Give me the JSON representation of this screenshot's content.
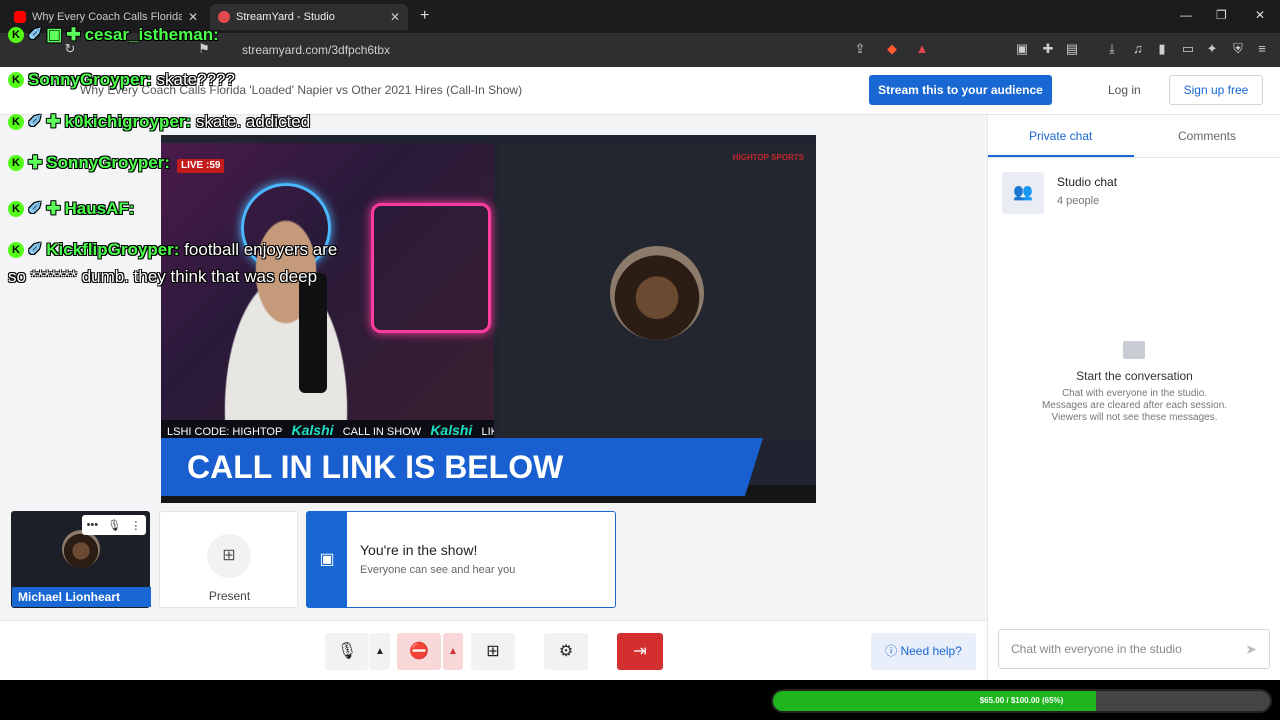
{
  "browser": {
    "tabs": [
      {
        "label": "Why Every Coach Calls Florida 'Loade",
        "favicon_color": "#ff0000"
      },
      {
        "label": "StreamYard - Studio",
        "favicon_color": "#e34b4b"
      }
    ],
    "url": "streamyard.com/3dfpch6tbx"
  },
  "header": {
    "show_title": "Why Every Coach Calls Florida 'Loaded' Napier vs Other 2021 Hires (Call-In Show)",
    "stream_button": "Stream this to your audience",
    "login": "Log in",
    "signup": "Sign up free"
  },
  "stage": {
    "live_badge": "LIVE :59",
    "ticker": [
      "LSHI CODE: HIGHTOP",
      "Kalshi",
      "CALL IN SHOW",
      "Kalshi",
      "LIKE"
    ],
    "banner": "CALL IN LINK IS BELOW",
    "logo": "HIGHTOP SPORTS"
  },
  "thumbs": {
    "guest_name": "Michael Lionheart",
    "present_label": "Present",
    "notice_title": "You're in the show!",
    "notice_sub": "Everyone can see and hear you"
  },
  "controls": {
    "help": "Need help?"
  },
  "sidebar": {
    "tabs": [
      "Private chat",
      "Comments"
    ],
    "room_name": "Studio chat",
    "room_count": "4 people",
    "empty_title": "Start the conversation",
    "empty_lines": [
      "Chat with everyone in the studio.",
      "Messages are cleared after each session.",
      "Viewers will not see these messages."
    ],
    "input_placeholder": "Chat with everyone in the studio"
  },
  "overlay_chat": [
    {
      "name": "cesar_istheman:",
      "message": ""
    },
    {
      "name": "SonnyGroyper:",
      "message": "skate????"
    },
    {
      "name": "k0kichigroyper:",
      "message": "skate. addicted"
    },
    {
      "name": "SonnyGroyper:",
      "message": ""
    },
    {
      "name": "HausAF:",
      "message": ""
    },
    {
      "name": "KickflipGroyper:",
      "message": "football enjoyers are"
    },
    {
      "name": "",
      "message": "so ******* dumb. they think that was deep"
    }
  ],
  "goal": {
    "text": "$65.00 / $100.00 (65%)",
    "progress": 0.65,
    "color": "#1fb51f"
  }
}
